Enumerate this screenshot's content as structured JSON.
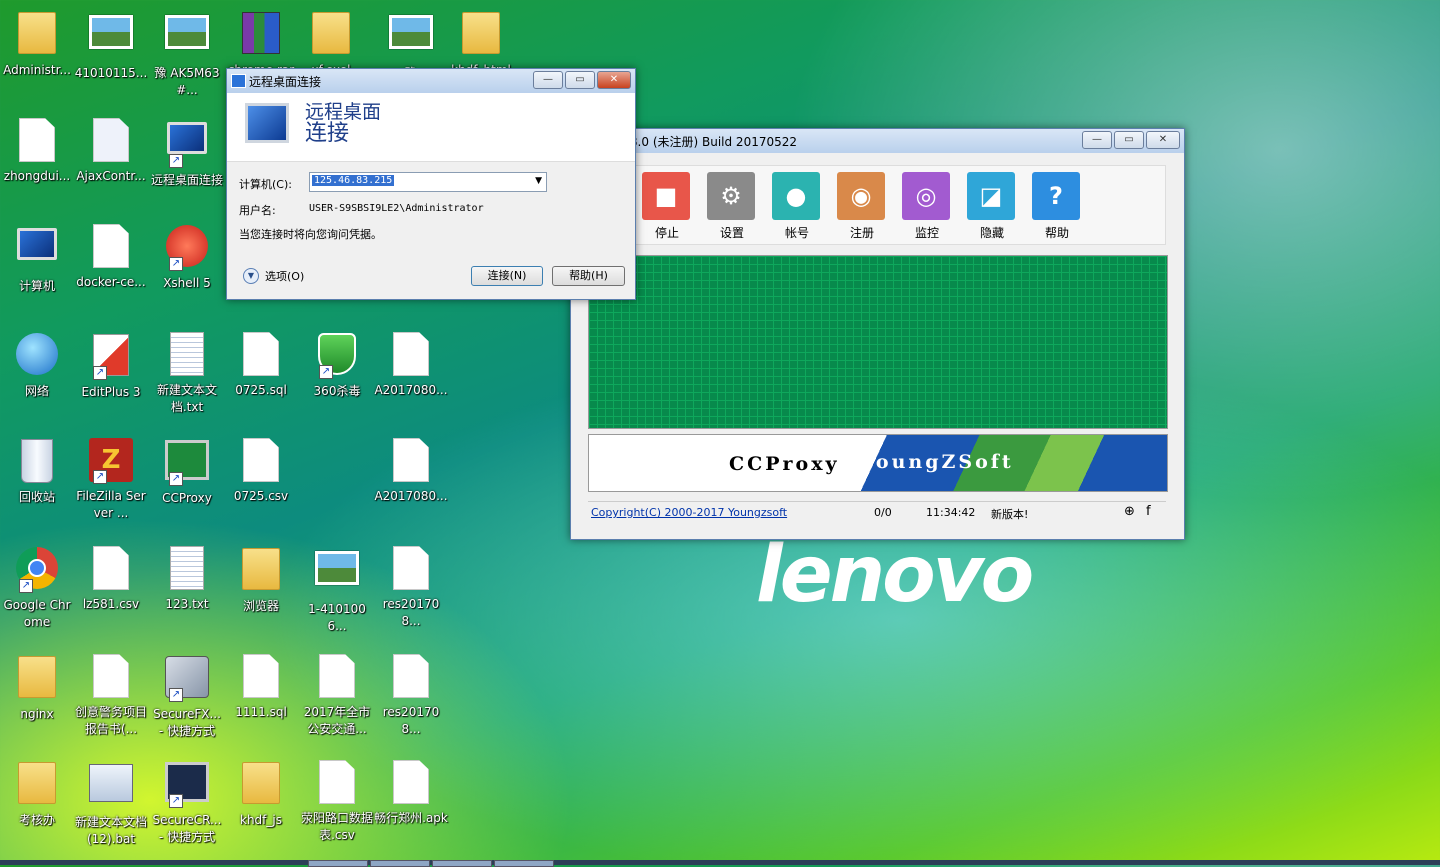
{
  "desktop": {
    "icons": [
      {
        "label": "Administr..."
      },
      {
        "label": "41010115..."
      },
      {
        "label": "豫 AK5M63#..."
      },
      {
        "label": "chrome.rar"
      },
      {
        "label": "xf.exel"
      },
      {
        "label": "豫"
      },
      {
        "label": "khdf_html"
      },
      {
        "label": "zhongdui..."
      },
      {
        "label": "AjaxContr..."
      },
      {
        "label": "远程桌面连接"
      },
      {
        "label": "计算机"
      },
      {
        "label": "docker-ce..."
      },
      {
        "label": "Xshell 5"
      },
      {
        "label": "网络"
      },
      {
        "label": "EditPlus 3"
      },
      {
        "label": "新建文本文档.txt"
      },
      {
        "label": "0725.sql"
      },
      {
        "label": "360杀毒"
      },
      {
        "label": "A2017080..."
      },
      {
        "label": "回收站"
      },
      {
        "label": "FileZilla Server ..."
      },
      {
        "label": "CCProxy"
      },
      {
        "label": "0725.csv"
      },
      {
        "label": "A2017080..."
      },
      {
        "label": "Google Chrome"
      },
      {
        "label": "lz581.csv"
      },
      {
        "label": "123.txt"
      },
      {
        "label": "浏览器"
      },
      {
        "label": "1-4101006..."
      },
      {
        "label": "res201708..."
      },
      {
        "label": "nginx"
      },
      {
        "label": "创意警务项目报告书(..."
      },
      {
        "label": "SecureFX... - 快捷方式"
      },
      {
        "label": "1111.sql"
      },
      {
        "label": "2017年全市公安交通..."
      },
      {
        "label": "res201708..."
      },
      {
        "label": "考核办"
      },
      {
        "label": "新建文本文档 (12).bat"
      },
      {
        "label": "SecureCR... - 快捷方式"
      },
      {
        "label": "khdf_js"
      },
      {
        "label": "荥阳路口数据表.csv"
      },
      {
        "label": "畅行郑州.apk"
      }
    ],
    "wallpaper_logo": "lenovo"
  },
  "rdp_dialog": {
    "title": "远程桌面连接",
    "heading_line1": "远程桌面",
    "heading_line2": "连接",
    "computer_label": "计算机(C):",
    "computer_value": "125.46.83.215",
    "username_label": "用户名:",
    "username_value": "USER-S9SBSI9LE2\\Administrator",
    "note": "当您连接时将向您询问凭据。",
    "options_label": "选项(O)",
    "connect_label": "连接(N)",
    "help_label": "帮助(H)"
  },
  "ccproxy": {
    "title": "y 8.0 (未注册) Build 20170522",
    "toolbar": [
      {
        "label": "停止",
        "icon": "stop-icon",
        "color": "#e8564a"
      },
      {
        "label": "设置",
        "icon": "gear-icon",
        "color": "#8a8a8a"
      },
      {
        "label": "帐号",
        "icon": "user-icon",
        "color": "#2bb3b0"
      },
      {
        "label": "注册",
        "icon": "globe-icon",
        "color": "#d9894a"
      },
      {
        "label": "监控",
        "icon": "eye-icon",
        "color": "#a25bd0"
      },
      {
        "label": "隐藏",
        "icon": "hide-icon",
        "color": "#2fa6d8"
      },
      {
        "label": "帮助",
        "icon": "help-icon",
        "color": "#2d8ee0"
      }
    ],
    "banner_left": "CCProxy",
    "banner_right": "YoungZSoft",
    "status": {
      "copyright": "Copyright(C) 2000-2017 Youngzsoft",
      "connections": "0/0",
      "time": "11:34:42",
      "update": "新版本!"
    }
  }
}
